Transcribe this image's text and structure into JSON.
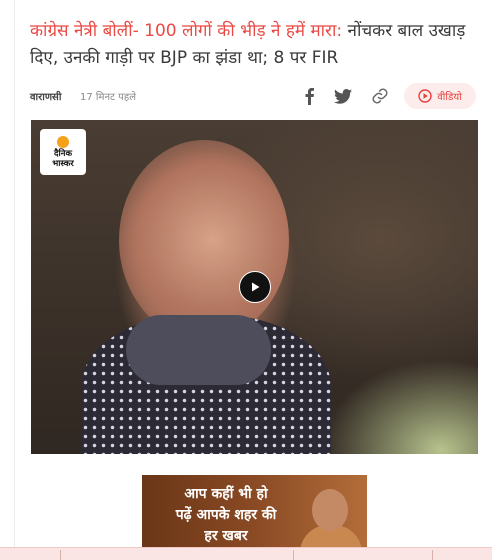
{
  "article": {
    "headline_highlight": "कांग्रेस नेत्री बोलीं- 100 लोगों की भीड़ ने हमें मारा:",
    "headline_rest": "नोंचकर बाल उखाड़ दिए, उनकी गाड़ी पर BJP का झंडा था; 8 पर FIR",
    "city": "वाराणसी",
    "time": "17 मिनट पहले"
  },
  "share": {
    "facebook_icon": "f",
    "twitter_icon": "twitter-bird",
    "link_icon": "link-chain"
  },
  "video_button": {
    "label": "वीडियो",
    "icon": "play-circle-icon"
  },
  "media": {
    "logo_line1": "दैनिक",
    "logo_line2": "भास्कर",
    "play_icon": "play-icon"
  },
  "ad": {
    "line1": "आप कहीं भी हो",
    "line2": "पढ़ें आपके शहर की",
    "line3": "हर खबर"
  },
  "colors": {
    "accent_red": "#ea4a45",
    "pill_bg": "#fdecec",
    "bottom_bar": "#fbe5e4"
  }
}
